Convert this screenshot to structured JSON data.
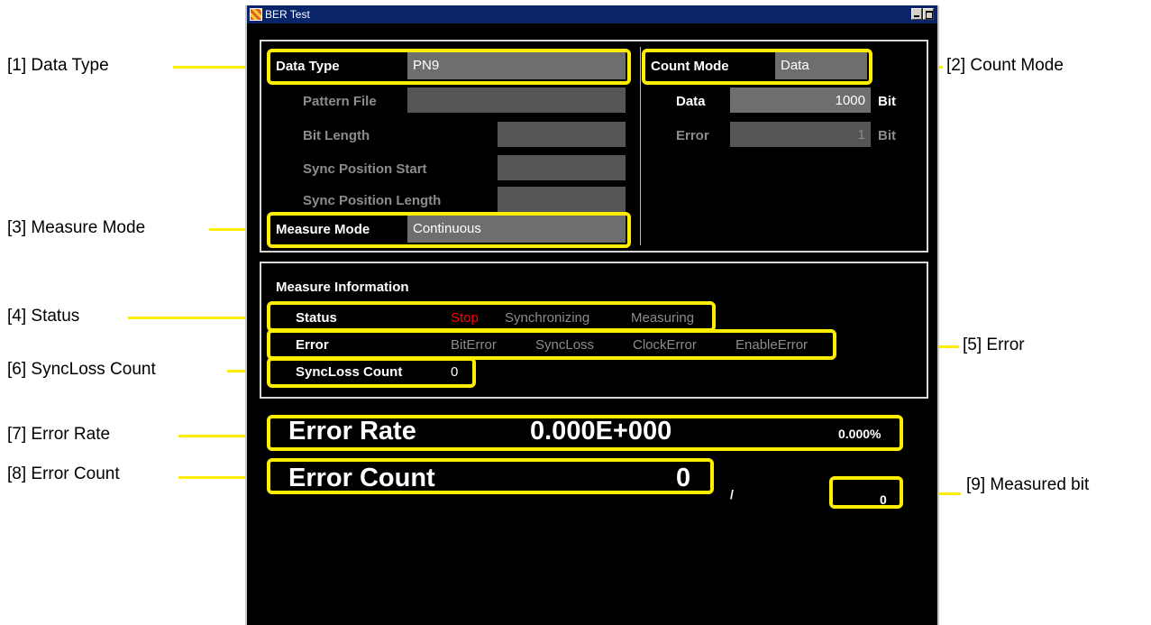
{
  "window": {
    "title": "BER Test"
  },
  "callouts": {
    "data_type": "[1] Data Type",
    "count_mode": "[2] Count Mode",
    "measure_mode": "[3] Measure Mode",
    "status": "[4] Status",
    "error": "[5] Error",
    "syncloss_count": "[6] SyncLoss Count",
    "error_rate": "[7] Error Rate",
    "error_count": "[8] Error Count",
    "measured_bit": "[9] Measured bit"
  },
  "settings": {
    "data_type_label": "Data Type",
    "data_type_value": "PN9",
    "pattern_file_label": "Pattern File",
    "pattern_file_value": "",
    "bit_length_label": "Bit Length",
    "bit_length_value": "",
    "sync_start_label": "Sync Position Start",
    "sync_start_value": "",
    "sync_length_label": "Sync Position Length",
    "sync_length_value": "",
    "measure_mode_label": "Measure Mode",
    "measure_mode_value": "Continuous",
    "count_mode_label": "Count Mode",
    "count_mode_value": "Data",
    "data_label": "Data",
    "data_value": "1000",
    "data_unit": "Bit",
    "error_label": "Error",
    "error_value": "1",
    "error_unit": "Bit"
  },
  "measure_info": {
    "title": "Measure Information",
    "status_label": "Status",
    "status_states": [
      "Stop",
      "Synchronizing",
      "Measuring"
    ],
    "status_active": "Stop",
    "error_label": "Error",
    "error_flags": [
      "BitError",
      "SyncLoss",
      "ClockError",
      "EnableError"
    ],
    "syncloss_label": "SyncLoss Count",
    "syncloss_value": "0"
  },
  "results": {
    "error_rate_label": "Error Rate",
    "error_rate_value": "0.000E+000",
    "error_rate_percent": "0.000%",
    "error_count_label": "Error Count",
    "error_count_value": "0",
    "separator": "/",
    "measured_bit_value": "0"
  },
  "colors": {
    "highlight": "#ffee00",
    "active_status": "#ff0000",
    "window_bg": "#000000"
  }
}
